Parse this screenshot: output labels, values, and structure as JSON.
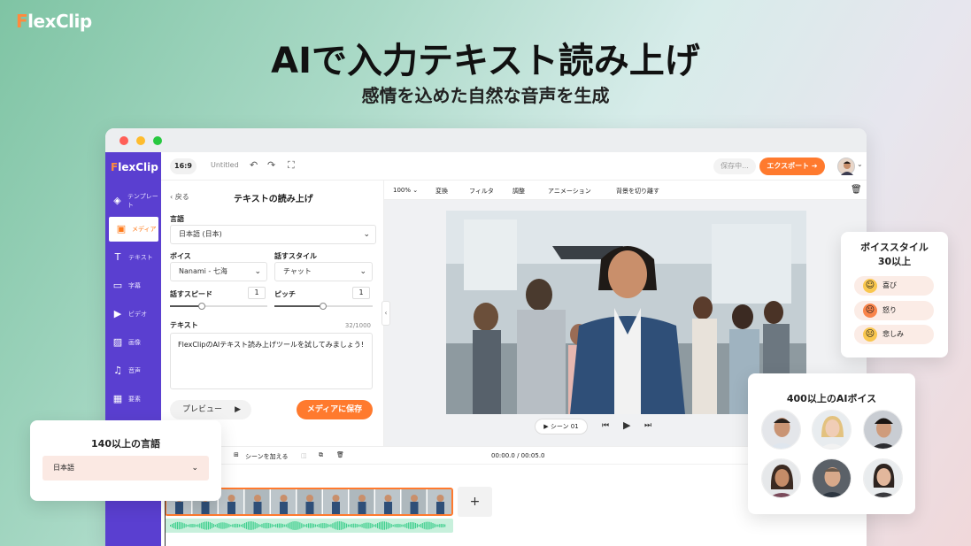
{
  "brand": {
    "logo_f": "F",
    "logo_rest": "lexClip"
  },
  "hero": {
    "headline": "AIで入力テキスト読み上げ",
    "subline": "感情を込めた自然な音声を生成"
  },
  "app": {
    "logo_f": "F",
    "logo_rest": "lexClip",
    "sidebar": {
      "items": [
        {
          "label": "テンプレート",
          "icon": "layers-icon",
          "glyph": "◈"
        },
        {
          "label": "メディア",
          "icon": "media-folder-icon",
          "glyph": "▣",
          "active": true
        },
        {
          "label": "テキスト",
          "icon": "text-icon",
          "glyph": "T"
        },
        {
          "label": "字幕",
          "icon": "subtitle-icon",
          "glyph": "▭"
        },
        {
          "label": "ビデオ",
          "icon": "video-icon",
          "glyph": "▶"
        },
        {
          "label": "画像",
          "icon": "image-icon",
          "glyph": "▨"
        },
        {
          "label": "音声",
          "icon": "music-icon",
          "glyph": "♫"
        },
        {
          "label": "要素",
          "icon": "elements-icon",
          "glyph": "▦"
        }
      ]
    },
    "topbar": {
      "ratio": "16:9",
      "title": "Untitled",
      "undo_glyph": "↶",
      "redo_glyph": "↷",
      "fullscreen_glyph": "⛶",
      "saving": "保存中...",
      "export": "エクスポート ➔"
    },
    "panel": {
      "back": "‹ 戻る",
      "title": "テキストの読み上げ",
      "language_label": "言語",
      "language_value": "日本語 (日本)",
      "voice_label": "ボイス",
      "voice_value": "Nanami - 七海",
      "style_label": "話すスタイル",
      "style_value": "チャット",
      "speed_label": "話すスピード",
      "speed_value": "1",
      "pitch_label": "ピッチ",
      "pitch_value": "1",
      "text_label": "テキスト",
      "char_count": "32/1000",
      "text_value": "FlexClipのAIテキスト読み上げツールを試してみましょう!",
      "preview": "プレビュー",
      "save": "メディアに保存"
    },
    "edit_toolbar": {
      "zoom": "100% ⌄",
      "transform": "変換",
      "filter": "フィルタ",
      "adjust": "調整",
      "animation": "アニメーション",
      "bg_remove": "背景を切り離す"
    },
    "player": {
      "scene": "▶ シーン 01"
    },
    "timeline": {
      "add_scene": "シーンを加える",
      "time": "00:00.0 / 00:05.0",
      "plus": "+"
    }
  },
  "language_card": {
    "title": "140以上の言語",
    "value": "日本語"
  },
  "style_card": {
    "title_line1": "ボイススタイル",
    "title_line2": "30以上",
    "styles": [
      {
        "label": "喜び",
        "face": "😊",
        "color": "#f9c74f"
      },
      {
        "label": "怒り",
        "face": "😠",
        "color": "#f9844a"
      },
      {
        "label": "悲しみ",
        "face": "🙁",
        "color": "#f9c74f"
      }
    ]
  },
  "voice_card": {
    "title": "400以上のAIボイス"
  },
  "colors": {
    "accent": "#ff7a2e",
    "sidebar": "#5a3fd0",
    "waveform": "#3fcf8e"
  }
}
